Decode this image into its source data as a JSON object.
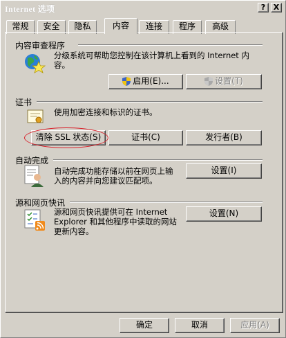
{
  "window": {
    "title": "Internet 选项",
    "help": "?",
    "close": "X"
  },
  "tabs": [
    {
      "label": "常规"
    },
    {
      "label": "安全"
    },
    {
      "label": "隐私"
    },
    {
      "label": "内容"
    },
    {
      "label": "连接"
    },
    {
      "label": "程序"
    },
    {
      "label": "高级"
    }
  ],
  "content_advisor": {
    "heading": "内容审查程序",
    "description_line1": "分级系统可帮助您控制在该计算机上看到的 Internet 内",
    "description_line2": "容。",
    "enable_button": "启用(E)...",
    "settings_button": "设置(T)"
  },
  "certificates": {
    "heading": "证书",
    "description": "使用加密连接和标识的证书。",
    "clear_ssl_button": "清除 SSL 状态(S)",
    "certificates_button": "证书(C)",
    "publishers_button": "发行者(B)"
  },
  "autocomplete": {
    "heading": "自动完成",
    "description_line1": "自动完成功能存储以前在网页上输",
    "description_line2": "入的内容并向您建议匹配项。",
    "settings_button": "设置(I)"
  },
  "feeds": {
    "heading": "源和网页快讯",
    "description_line1": "源和网页快讯提供可在 Internet",
    "description_line2": "Explorer 和其他程序中读取的网站",
    "description_line3": "更新内容。",
    "settings_button": "设置(N)"
  },
  "footer": {
    "ok": "确定",
    "cancel": "取消",
    "apply": "应用(A)"
  },
  "colors": {
    "face": "#d4d0c8",
    "shadow": "#808080",
    "highlight_ring": "#d9202a"
  }
}
